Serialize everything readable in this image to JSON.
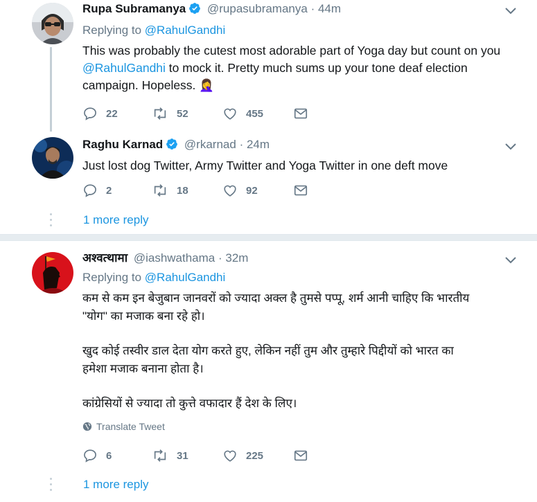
{
  "colors": {
    "link": "#1b95e0",
    "muted": "#657786",
    "text": "#14171a",
    "verified": "#1da1f2",
    "thread": "#c4cfd6"
  },
  "tweets": [
    {
      "name": "Rupa Subramanya",
      "verified": true,
      "handle": "@rupasubramanya",
      "time": "· 44m",
      "replying_label": "Replying to",
      "replying_handle": "@RahulGandhi",
      "text_1": "This was probably the cutest most adorable part of Yoga day but count on you",
      "mention_2": "@RahulGandhi",
      "text_2": " to mock it. Pretty much sums up your tone deaf election",
      "text_3": "campaign. Hopeless. 🤦‍♀️",
      "replies": "22",
      "retweets": "52",
      "likes": "455",
      "icons": [
        "reply-icon",
        "retweet-icon",
        "like-icon",
        "message-icon",
        "caret-down-icon",
        "verified-icon"
      ]
    },
    {
      "name": "Raghu Karnad",
      "verified": true,
      "handle": "@rkarnad",
      "time": "· 24m",
      "text": "Just lost dog Twitter, Army Twitter and  Yoga Twitter in one deft move",
      "replies": "2",
      "retweets": "18",
      "likes": "92"
    },
    {
      "name": "अश्वत्थामा",
      "verified": false,
      "handle": "@iashwathama",
      "time": "· 32m",
      "replying_label": "Replying to",
      "replying_handle": "@RahulGandhi",
      "para_1_line_1": "कम से कम इन बेजुबान जानवरों को ज्यादा अक्ल है तुमसे पप्पू, शर्म आनी चाहिए कि भारतीय",
      "para_1_line_2": "\"योग\" का मजाक बना रहे हो।",
      "para_2_line_1": "खुद कोई तस्वीर डाल देता योग करते हुए, लेकिन नहीं तुम और तुम्हारे पिद्दीयों को भारत का",
      "para_2_line_2": "हमेशा मजाक बनाना होता है।",
      "para_3_line_1": "कांग्रेसियों से ज्यादा तो कुत्ते वफादार हैं देश के लिए।",
      "translate_label": "Translate Tweet",
      "replies": "6",
      "retweets": "31",
      "likes": "225"
    }
  ],
  "more_reply_1": "1 more reply",
  "more_reply_2": "1 more reply"
}
